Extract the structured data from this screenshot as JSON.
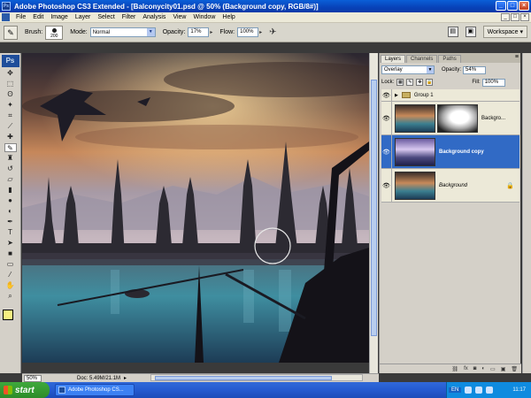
{
  "window": {
    "title": "Adobe Photoshop CS3 Extended - [Balconycity01.psd @ 50% (Background copy, RGB/8#)]",
    "controls": [
      "_",
      "□",
      "×"
    ]
  },
  "menu": {
    "items": [
      "File",
      "Edit",
      "Image",
      "Layer",
      "Select",
      "Filter",
      "Analysis",
      "View",
      "Window",
      "Help"
    ],
    "doc_controls": [
      "_",
      "□",
      "×"
    ]
  },
  "options": {
    "brush_label": "Brush:",
    "brush_size": "200",
    "mode_label": "Mode:",
    "mode_value": "Normal",
    "opacity_label": "Opacity:",
    "opacity_value": "17%",
    "flow_label": "Flow:",
    "flow_value": "100%",
    "workspace_label": "Workspace ▾"
  },
  "toolbox": {
    "logo": "Ps",
    "tools": [
      "move-icon",
      "marquee-icon",
      "lasso-icon",
      "magic-wand-icon",
      "crop-icon",
      "slice-icon",
      "healing-icon",
      "brush-icon",
      "stamp-icon",
      "history-brush-icon",
      "eraser-icon",
      "gradient-icon",
      "blur-icon",
      "dodge-icon",
      "pen-icon",
      "type-icon",
      "path-select-icon",
      "shape-icon",
      "notes-icon",
      "eyedropper-icon",
      "hand-icon",
      "zoom-icon"
    ],
    "foreground_color": "#f8f080",
    "background_color": "#2a58b8"
  },
  "status": {
    "zoom": "50%",
    "doc": "Doc: 5.49M/21.1M"
  },
  "layers_panel": {
    "tabs": [
      "Layers",
      "Channels",
      "Paths"
    ],
    "blend_mode": "Overlay",
    "opacity_label": "Opacity:",
    "opacity_value": "54%",
    "lock_label": "Lock:",
    "fill_label": "Fill:",
    "fill_value": "100%",
    "layers": [
      {
        "name": "Group 1",
        "type": "group"
      },
      {
        "name": "Backgro...",
        "type": "masked"
      },
      {
        "name": "Background copy",
        "type": "selected"
      },
      {
        "name": "Background",
        "type": "locked"
      }
    ],
    "bottom_icons": [
      "link-icon",
      "fx-icon",
      "mask-icon",
      "adjustment-icon",
      "folder-icon",
      "new-layer-icon",
      "trash-icon"
    ]
  },
  "taskbar": {
    "start": "start",
    "task_label": "Adobe Photoshop CS...",
    "lang": "EN",
    "clock": "11:17"
  }
}
